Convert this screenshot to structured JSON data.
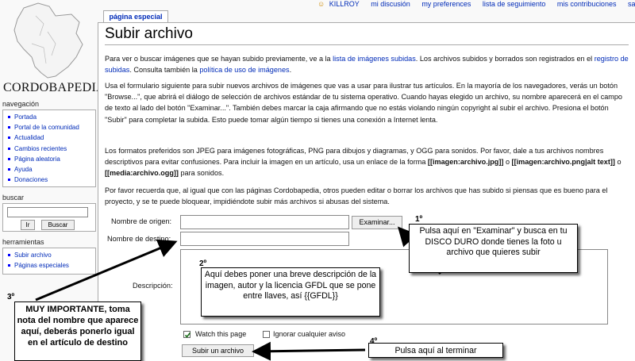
{
  "logo": {
    "text": "CORDOBAPEDIA"
  },
  "personal_links": [
    "KILLROY",
    "mi discusión",
    "my preferences",
    "lista de seguimiento",
    "mis contribuciones",
    "salir"
  ],
  "tab": "página especial",
  "title": "Subir archivo",
  "sidebar": {
    "navigation_title": "navegación",
    "navigation": [
      "Portada",
      "Portal de la comunidad",
      "Actualidad",
      "Cambios recientes",
      "Página aleatoria",
      "Ayuda",
      "Donaciones"
    ],
    "search_title": "buscar",
    "search_go": "Ir",
    "search_button": "Buscar",
    "tools_title": "herramientas",
    "tools": [
      "Subir archivo",
      "Páginas especiales"
    ]
  },
  "paragraphs": {
    "p1_a": "Para ver o buscar imágenes que se hayan subido previamente, ve a la ",
    "p1_link1": "lista de imágenes subidas",
    "p1_b": ". Los archivos subidos y borrados son registrados en el ",
    "p1_link2": "registro de subidas",
    "p1_c": ". Consulta también la ",
    "p1_link3": "política de uso de imágenes",
    "p1_d": ".",
    "p2": "Usa el formulario siguiente para subir nuevos archivos de imágenes que vas a usar para ilustrar tus artículos. En la mayoría de los navegadores, verás un botón \"Browse...\", que abrirá el diálogo de selección de archivos estándar de tu sistema operativo. Cuando hayas elegido un archivo, su nombre aparecerá en el campo de texto al lado del botón \"Examinar...\". También debes marcar la caja afirmando que no estás violando ningún copyright al subir el archivo. Presiona el botón \"Subir\" para completar la subida. Esto puede tomar algún tiempo si tienes una conexión a Internet lenta.",
    "p3_a": "Los formatos preferidos son JPEG para imágenes fotográficas, PNG para dibujos y diagramas, y OGG para sonidos. Por favor, dale a tus archivos nombres descriptivos para evitar confusiones. Para incluir la imagen en un artículo, usa un enlace de la forma ",
    "p3_b1": "[[imagen:archivo.jpg]]",
    "p3_c": " o ",
    "p3_b2": "[[imagen:archivo.png|alt text]]",
    "p3_d": " o ",
    "p3_b3": "[[media:archivo.ogg]]",
    "p3_e": " para sonidos.",
    "p4": "Por favor recuerda que, al igual que con las páginas Cordobapedia, otros pueden editar o borrar los archivos que has subido si piensas que es bueno para el proyecto, y se te puede bloquear, impidiéndote subir más archivos si abusas del sistema."
  },
  "form": {
    "source_label": "Nombre de origen:",
    "browse_button": "Examinar...",
    "dest_label": "Nombre de destino:",
    "desc_label": "Descripción:",
    "watch_label": "Watch this page",
    "watch_checked": true,
    "ignore_label": "Ignorar cualquier aviso",
    "ignore_checked": false,
    "submit": "Subir un archivo"
  },
  "annotations": {
    "n1": "1º",
    "t1": "Pulsa aquí en \"Examinar\" y busca en tu DISCO DURO donde tienes la foto u archivo que quieres subir",
    "n2": "2º",
    "t2": "Aquí debes poner una breve descripción de la imagen, autor y la licencia GFDL que se pone entre llaves, así {{GFDL}}",
    "n3": "3º",
    "t3": "MUY IMPORTANTE, toma nota del nombre que aparece aquí, deberás ponerlo igual en el artículo de destino",
    "n4": "4º",
    "t4": "Pulsa aquí al terminar"
  },
  "colors": {
    "link": "#002bb8",
    "border": "#aaaaaa",
    "annotation_box": "#ffffff"
  }
}
